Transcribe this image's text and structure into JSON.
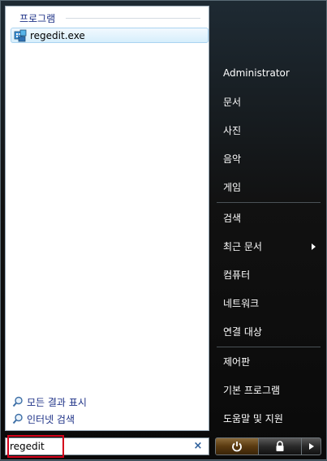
{
  "left": {
    "section_header": "프로그램",
    "results": [
      {
        "label": "regedit.exe",
        "icon": "regedit-icon"
      }
    ],
    "see_all_results": "모든 결과 표시",
    "search_internet": "인터넷 검색"
  },
  "search": {
    "value": "regedit",
    "clear_icon": "×"
  },
  "right": {
    "items": [
      "Administrator",
      "문서",
      "사진",
      "음악",
      "게임",
      "검색",
      "최근 문서",
      "컴퓨터",
      "네트워크",
      "연결 대상",
      "제어판",
      "기본 프로그램",
      "도움말 및 지원"
    ]
  },
  "colors": {
    "highlight_border": "#d4001a",
    "link_blue": "#1e3287",
    "power_orange": "#8a6a3a"
  }
}
